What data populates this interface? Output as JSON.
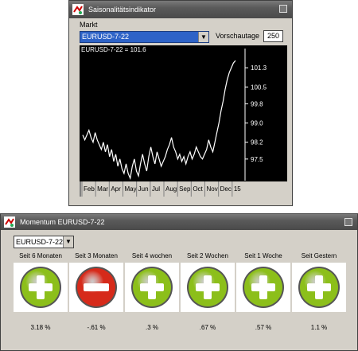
{
  "window1": {
    "title": "Saisonalitätsindikator",
    "markt_label": "Markt",
    "market_value": "EURUSD-7-22",
    "vorschau_label": "Vorschautage",
    "vorschau_value": "250"
  },
  "chart_data": {
    "type": "line",
    "title": "EURUSD-7-22 = 101.6",
    "x_tick_labels": [
      "Feb",
      "Mar",
      "Apr",
      "May",
      "Jun",
      "Jul",
      "Aug",
      "Sep",
      "Oct",
      "Nov",
      "Dec",
      "15"
    ],
    "y_tick_labels": [
      "101.3",
      "100.5",
      "99.8",
      "99.0",
      "98.2",
      "97.5"
    ],
    "ylim": [
      96.6,
      101.9
    ],
    "series": [
      {
        "values": [
          98.5,
          98.3,
          98.5,
          98.7,
          98.4,
          98.2,
          98.6,
          98.3,
          98.1,
          97.9,
          98.2,
          97.8,
          98.1,
          97.6,
          97.9,
          97.4,
          97.7,
          97.2,
          97.5,
          97.1,
          96.9,
          97.3,
          96.9,
          96.7,
          97.2,
          97.5,
          97.0,
          96.8,
          97.3,
          97.7,
          97.3,
          97.0,
          97.6,
          98.0,
          97.6,
          97.3,
          97.8,
          97.5,
          97.2,
          97.4,
          97.6,
          97.9,
          98.1,
          98.4,
          98.0,
          97.8,
          97.5,
          97.7,
          97.4,
          97.6,
          97.3,
          97.6,
          97.8,
          97.5,
          97.7,
          98.0,
          97.8,
          97.6,
          97.5,
          97.7,
          97.9,
          98.3,
          98.0,
          97.8,
          98.2,
          98.6,
          99.0,
          99.5,
          99.9,
          100.4,
          100.8,
          101.1,
          101.3,
          101.5,
          101.6
        ]
      }
    ]
  },
  "window2": {
    "title": "Momentum EURUSD-7-22",
    "market_value": "EURUSD-7-22",
    "columns": [
      {
        "label": "Seit 6 Monaten",
        "value": "3.18 %",
        "signal": "plus"
      },
      {
        "label": "Seit 3 Monaten",
        "value": "-.61 %",
        "signal": "minus"
      },
      {
        "label": "Seit 4 wochen",
        "value": ".3 %",
        "signal": "plus"
      },
      {
        "label": "Seit 2 Wochen",
        "value": ".67 %",
        "signal": "plus"
      },
      {
        "label": "Seit 1 Woche",
        "value": ".57 %",
        "signal": "plus"
      },
      {
        "label": "Seit Gestern",
        "value": "1.1 %",
        "signal": "plus"
      }
    ]
  },
  "colors": {
    "plus": "#8cbf1a",
    "minus": "#d62a1a",
    "chart_bg": "#000000",
    "line": "#ffffff"
  }
}
